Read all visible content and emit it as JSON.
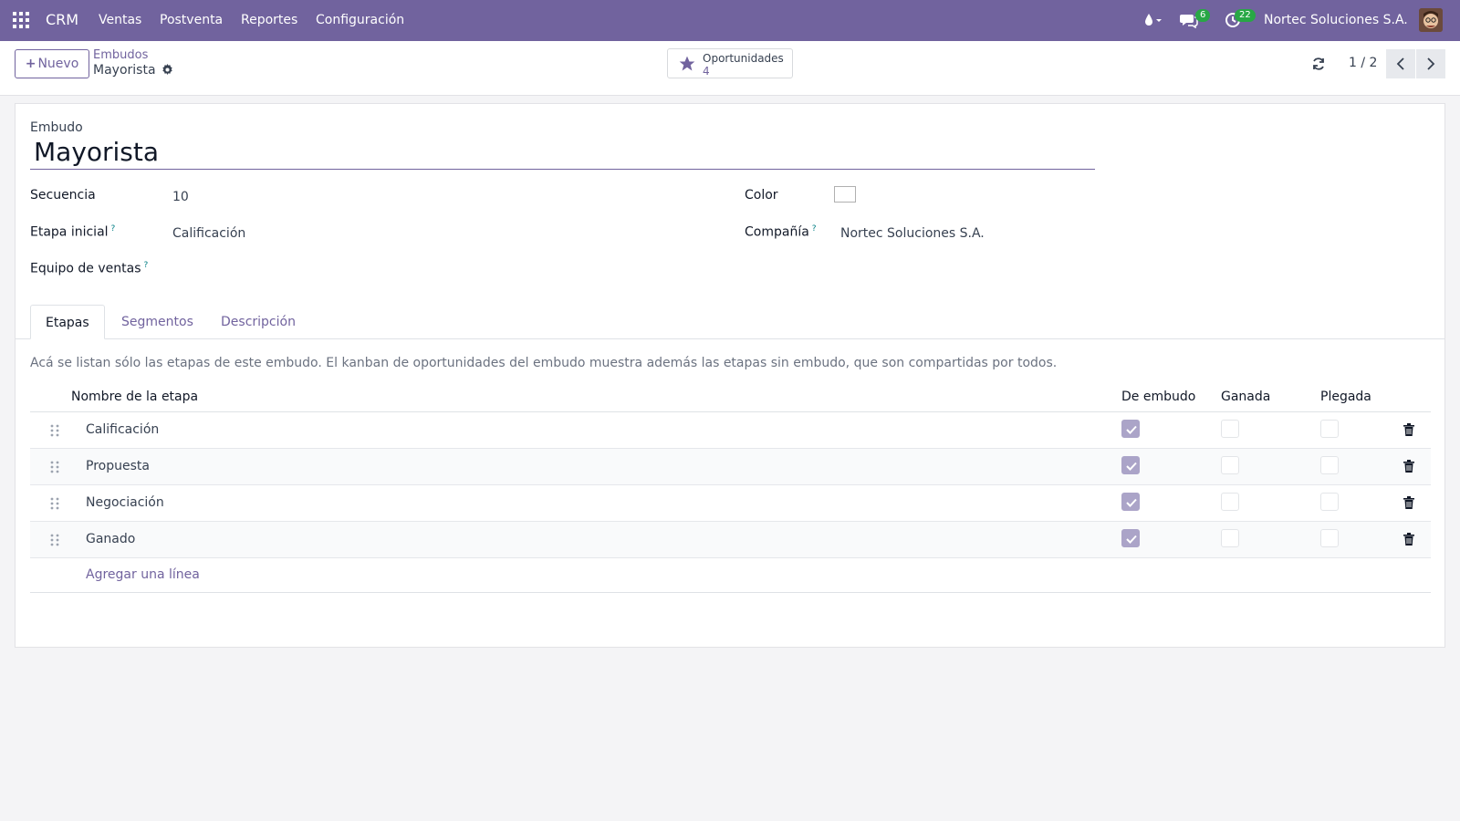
{
  "navbar": {
    "app_name": "CRM",
    "menu": [
      "Ventas",
      "Postventa",
      "Reportes",
      "Configuración"
    ],
    "messages_count": "6",
    "activities_count": "22",
    "company": "Nortec Soluciones S.A."
  },
  "control_panel": {
    "new_label": "Nuevo",
    "breadcrumb_parent": "Embudos",
    "breadcrumb_current": "Mayorista",
    "smart_button_label": "Oportunidades",
    "smart_button_count": "4",
    "pager": "1 / 2"
  },
  "form": {
    "title_label": "Embudo",
    "name": "Mayorista",
    "sequence_label": "Secuencia",
    "sequence_value": "10",
    "initial_stage_label": "Etapa inicial",
    "initial_stage_value": "Calificación",
    "sales_team_label": "Equipo de ventas",
    "color_label": "Color",
    "company_label": "Compañía",
    "company_value": "Nortec Soluciones S.A.",
    "help_marker": "?"
  },
  "tabs": [
    "Etapas",
    "Segmentos",
    "Descripción"
  ],
  "stages": {
    "help_text": "Acá se listan sólo las etapas de este embudo. El kanban de oportunidades del embudo muestra además las etapas sin embudo, que son compartidas por todos.",
    "columns": [
      "Nombre de la etapa",
      "De embudo",
      "Ganada",
      "Plegada"
    ],
    "rows": [
      {
        "name": "Calificación",
        "de_embudo": true,
        "ganada": false,
        "plegada": false
      },
      {
        "name": "Propuesta",
        "de_embudo": true,
        "ganada": false,
        "plegada": false
      },
      {
        "name": "Negociación",
        "de_embudo": true,
        "ganada": false,
        "plegada": false
      },
      {
        "name": "Ganado",
        "de_embudo": true,
        "ganada": false,
        "plegada": false
      }
    ],
    "add_line": "Agregar una línea"
  },
  "colors": {
    "brand": "#71639e",
    "badge": "#28a745",
    "checkbox_checked": "#aba4c8"
  },
  "icons": [
    "apps-grid-icon",
    "drop-icon",
    "chat-icon",
    "clock-icon",
    "star-icon",
    "gear-icon",
    "refresh-icon",
    "chevron-left-icon",
    "chevron-right-icon",
    "drag-handle-icon",
    "trash-icon"
  ]
}
